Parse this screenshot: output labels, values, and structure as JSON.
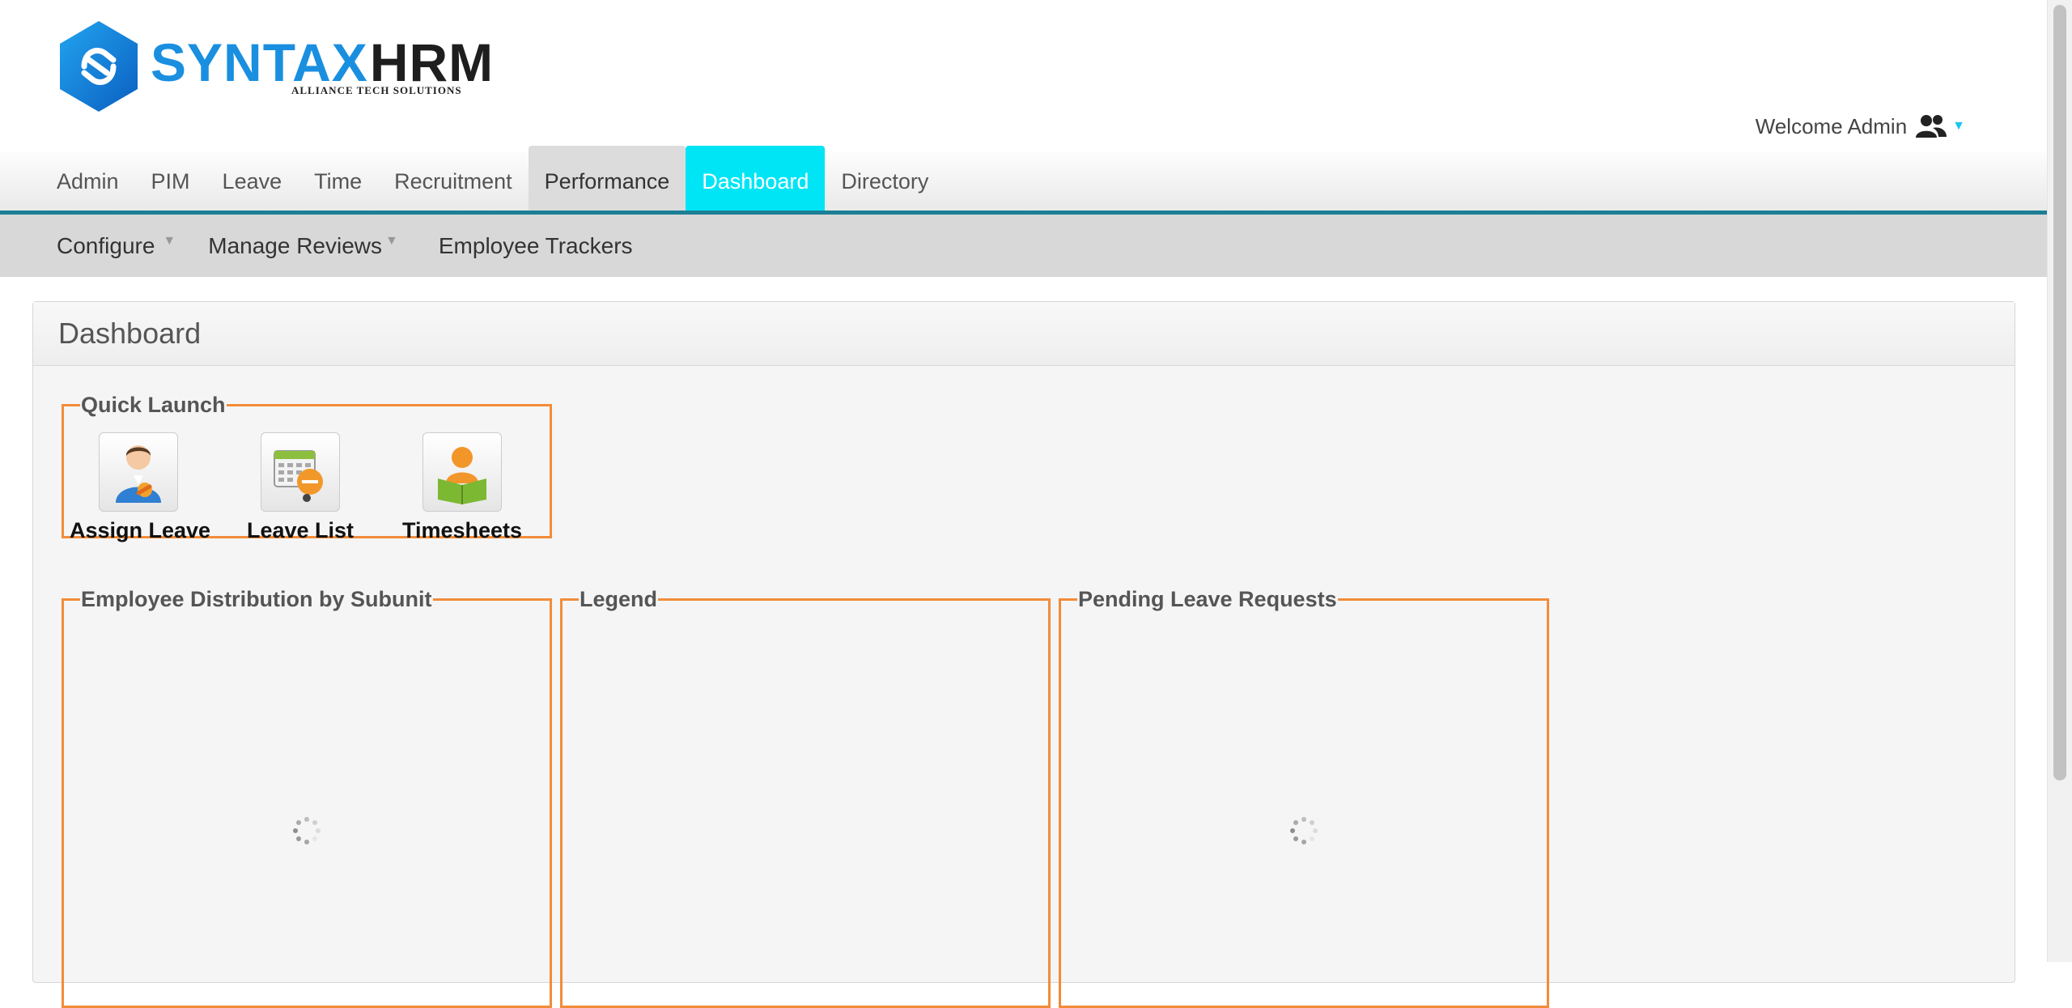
{
  "brand": {
    "name_part1": "SYNTAX",
    "name_part2": "HRM",
    "tagline": "ALLIANCE TECH SOLUTIONS"
  },
  "header": {
    "welcome_text": "Welcome Admin"
  },
  "main_menu": {
    "items": [
      {
        "label": "Admin"
      },
      {
        "label": "PIM"
      },
      {
        "label": "Leave"
      },
      {
        "label": "Time"
      },
      {
        "label": "Recruitment"
      },
      {
        "label": "Performance",
        "state": "current"
      },
      {
        "label": "Dashboard",
        "state": "highlighted"
      },
      {
        "label": "Directory"
      }
    ]
  },
  "sub_menu": {
    "items": [
      {
        "label": "Configure",
        "has_dropdown": true
      },
      {
        "label": "Manage Reviews",
        "has_dropdown": true
      },
      {
        "label": "Employee Trackers",
        "has_dropdown": false
      }
    ]
  },
  "page": {
    "title": "Dashboard"
  },
  "quick_launch": {
    "title": "Quick Launch",
    "items": [
      {
        "label": "Assign Leave",
        "icon": "assign-leave-icon"
      },
      {
        "label": "Leave List",
        "icon": "leave-list-icon"
      },
      {
        "label": "Timesheets",
        "icon": "timesheets-icon"
      }
    ]
  },
  "panels": {
    "distribution_title": "Employee Distribution by Subunit",
    "legend_title": "Legend",
    "pending_title": "Pending Leave Requests"
  },
  "colors": {
    "accent_cyan": "#00e5f6",
    "menu_underline": "#1c7f96",
    "panel_border": "#f28c3a",
    "brand_blue": "#1a8fe0"
  }
}
